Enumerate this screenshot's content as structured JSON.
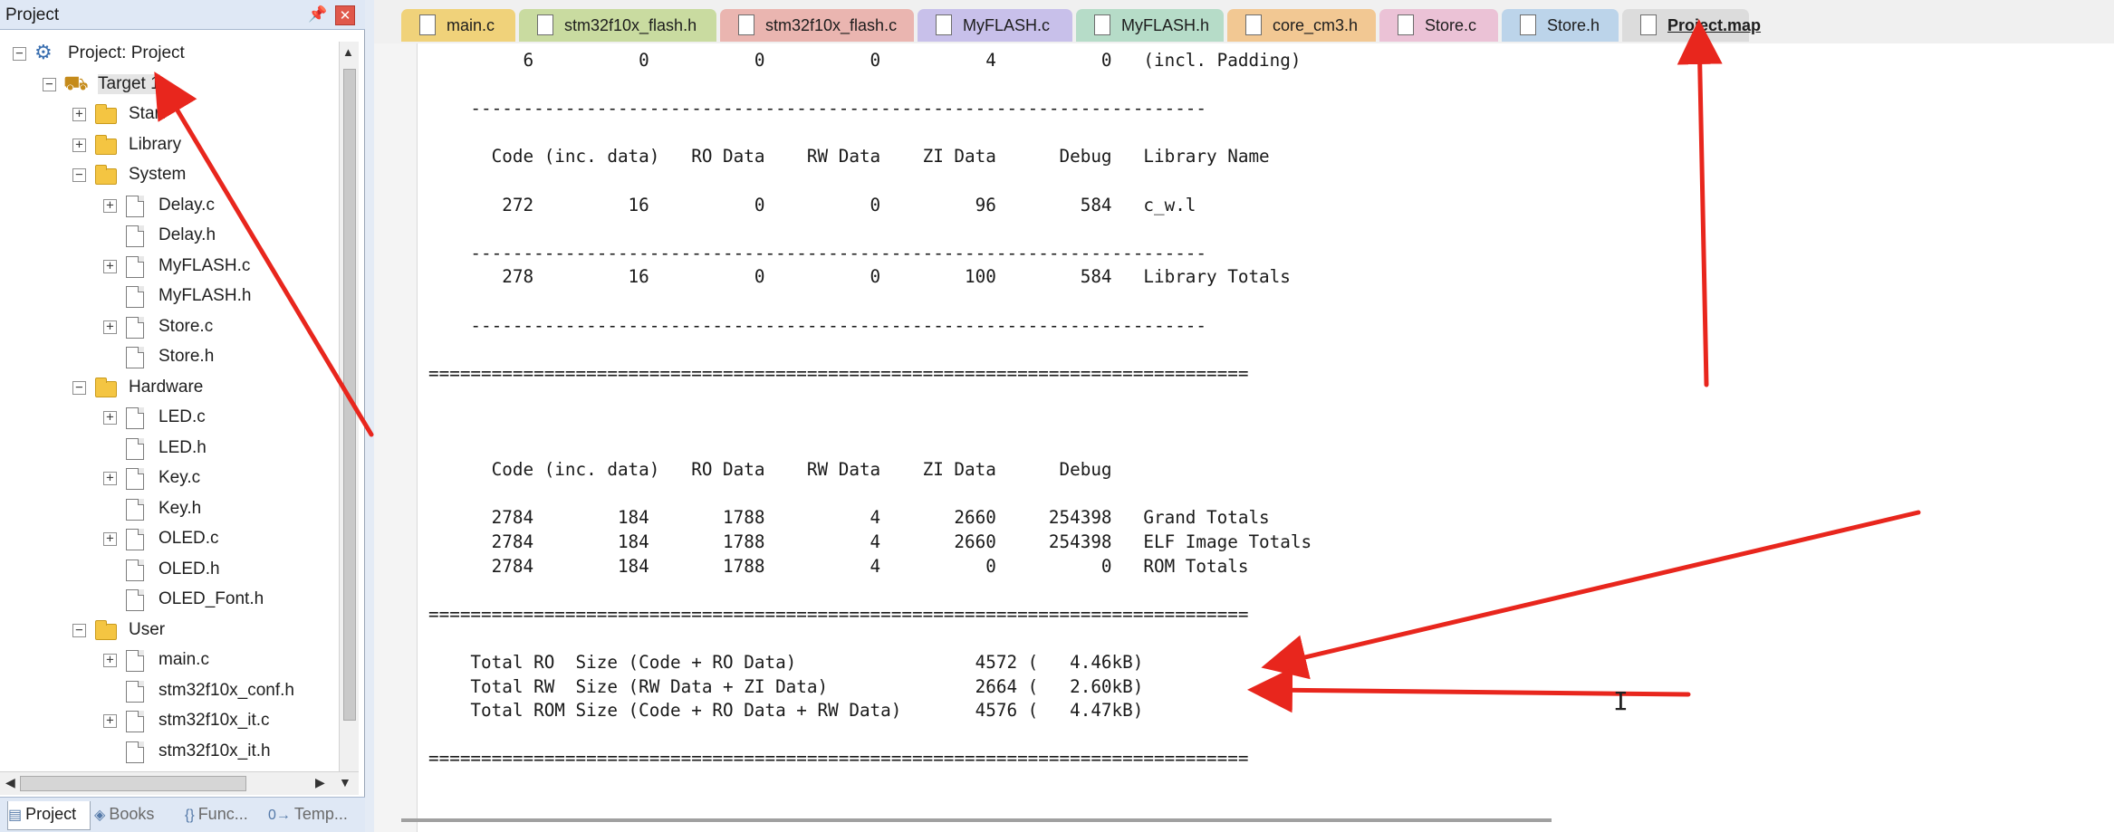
{
  "project_pane": {
    "title": "Project",
    "pin_glyph": "📌",
    "close_glyph": "✕",
    "tree": [
      {
        "label": "Project: Project",
        "depth": 0,
        "toggle": "−",
        "icon": "project-icon"
      },
      {
        "label": "Target 1",
        "depth": 1,
        "toggle": "−",
        "icon": "target-icon",
        "selected": true
      },
      {
        "label": "Start",
        "depth": 2,
        "toggle": "+",
        "icon": "folder-icon"
      },
      {
        "label": "Library",
        "depth": 2,
        "toggle": "+",
        "icon": "folder-icon"
      },
      {
        "label": "System",
        "depth": 2,
        "toggle": "−",
        "icon": "folder-icon"
      },
      {
        "label": "Delay.c",
        "depth": 3,
        "toggle": "+",
        "icon": "file-icon"
      },
      {
        "label": "Delay.h",
        "depth": 3,
        "toggle": "",
        "icon": "file-icon"
      },
      {
        "label": "MyFLASH.c",
        "depth": 3,
        "toggle": "+",
        "icon": "file-icon"
      },
      {
        "label": "MyFLASH.h",
        "depth": 3,
        "toggle": "",
        "icon": "file-icon"
      },
      {
        "label": "Store.c",
        "depth": 3,
        "toggle": "+",
        "icon": "file-icon"
      },
      {
        "label": "Store.h",
        "depth": 3,
        "toggle": "",
        "icon": "file-icon"
      },
      {
        "label": "Hardware",
        "depth": 2,
        "toggle": "−",
        "icon": "folder-icon"
      },
      {
        "label": "LED.c",
        "depth": 3,
        "toggle": "+",
        "icon": "file-icon"
      },
      {
        "label": "LED.h",
        "depth": 3,
        "toggle": "",
        "icon": "file-icon"
      },
      {
        "label": "Key.c",
        "depth": 3,
        "toggle": "+",
        "icon": "file-icon"
      },
      {
        "label": "Key.h",
        "depth": 3,
        "toggle": "",
        "icon": "file-icon"
      },
      {
        "label": "OLED.c",
        "depth": 3,
        "toggle": "+",
        "icon": "file-icon"
      },
      {
        "label": "OLED.h",
        "depth": 3,
        "toggle": "",
        "icon": "file-icon"
      },
      {
        "label": "OLED_Font.h",
        "depth": 3,
        "toggle": "",
        "icon": "file-icon"
      },
      {
        "label": "User",
        "depth": 2,
        "toggle": "−",
        "icon": "folder-icon"
      },
      {
        "label": "main.c",
        "depth": 3,
        "toggle": "+",
        "icon": "file-icon"
      },
      {
        "label": "stm32f10x_conf.h",
        "depth": 3,
        "toggle": "",
        "icon": "file-icon"
      },
      {
        "label": "stm32f10x_it.c",
        "depth": 3,
        "toggle": "+",
        "icon": "file-icon"
      },
      {
        "label": "stm32f10x_it.h",
        "depth": 3,
        "toggle": "",
        "icon": "file-icon"
      }
    ],
    "bottom_tabs": [
      {
        "label": "Project",
        "glyph": "▤",
        "active": true
      },
      {
        "label": "Books",
        "glyph": "◈",
        "active": false
      },
      {
        "label": "Func...",
        "glyph": "{}",
        "active": false
      },
      {
        "label": "Temp...",
        "glyph": "0→",
        "active": false
      }
    ]
  },
  "file_tabs": [
    {
      "label": "main.c",
      "color": "#f0d27a",
      "active": false
    },
    {
      "label": "stm32f10x_flash.h",
      "color": "#c9dba0",
      "active": false
    },
    {
      "label": "stm32f10x_flash.c",
      "color": "#eab5b0",
      "active": false
    },
    {
      "label": "MyFLASH.c",
      "color": "#c8c0ea",
      "active": false
    },
    {
      "label": "MyFLASH.h",
      "color": "#b6dcc8",
      "active": false
    },
    {
      "label": "core_cm3.h",
      "color": "#f2c893",
      "active": false
    },
    {
      "label": "Store.c",
      "color": "#ebc2d6",
      "active": false
    },
    {
      "label": "Store.h",
      "color": "#bcd4ea",
      "active": false
    },
    {
      "label": "Project.map",
      "color": "#dcdcdc",
      "active": true
    }
  ],
  "editor_lines": [
    "         6          0          0          0          4          0   (incl. Padding)",
    "",
    "    ----------------------------------------------------------------------",
    "",
    "      Code (inc. data)   RO Data    RW Data    ZI Data      Debug   Library Name",
    "",
    "       272         16          0          0         96        584   c_w.l",
    "",
    "    ----------------------------------------------------------------------",
    "       278         16          0          0        100        584   Library Totals",
    "",
    "    ----------------------------------------------------------------------",
    "",
    "==============================================================================",
    "",
    "",
    "",
    "      Code (inc. data)   RO Data    RW Data    ZI Data      Debug",
    "",
    "      2784        184       1788          4       2660     254398   Grand Totals",
    "      2784        184       1788          4       2660     254398   ELF Image Totals",
    "      2784        184       1788          4          0          0   ROM Totals",
    "",
    "==============================================================================",
    "",
    "    Total RO  Size (Code + RO Data)                 4572 (   4.46kB)",
    "    Total RW  Size (RW Data + ZI Data)              2664 (   2.60kB)",
    "    Total ROM Size (Code + RO Data + RW Data)       4576 (   4.47kB)",
    "",
    "=============================================================================="
  ],
  "annotation_color": "#e8261d"
}
